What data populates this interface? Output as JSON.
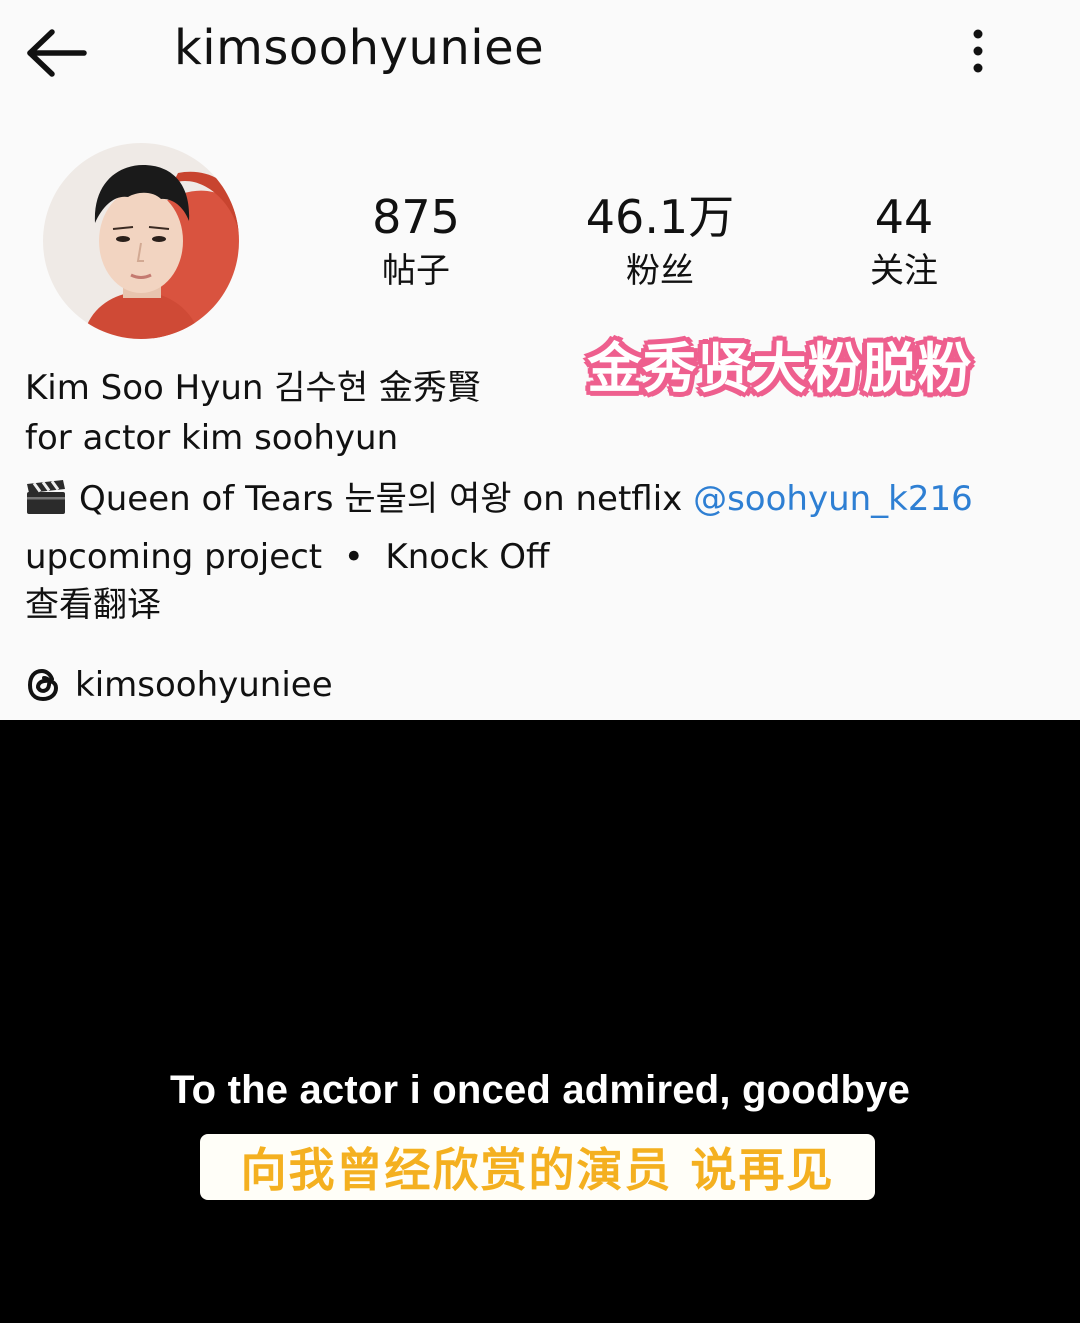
{
  "header": {
    "username": "kimsoohyuniee",
    "back_icon": "arrow-left-icon",
    "more_icon": "more-vertical-icon"
  },
  "stats": [
    {
      "value": "875",
      "label": "帖子"
    },
    {
      "value": "46.1万",
      "label": "粉丝"
    },
    {
      "value": "44",
      "label": "关注"
    }
  ],
  "overlay_tag": {
    "text": "金秀贤大粉脱粉",
    "fill_color": "#ffffff",
    "outline_color": "#ee5f8e"
  },
  "bio": {
    "name": "Kim Soo Hyun 김수현 金秀賢",
    "line1": "for actor kim soohyun",
    "line2_text": "Queen of Tears 눈물의 여왕 on netflix ",
    "line2_icon": "clapperboard-icon",
    "mention": "@soohyun_k216",
    "line3": "upcoming project  •  Knock Off",
    "translate": "查看翻译",
    "mention_color": "#2e7fd3"
  },
  "threads": {
    "icon": "threads-icon",
    "handle": "kimsoohyuniee"
  },
  "subtitles": {
    "english": "To the actor i onced admired, goodbye",
    "chinese": "向我曾经欣赏的演员 说再见",
    "chinese_color": "#f4b020"
  }
}
